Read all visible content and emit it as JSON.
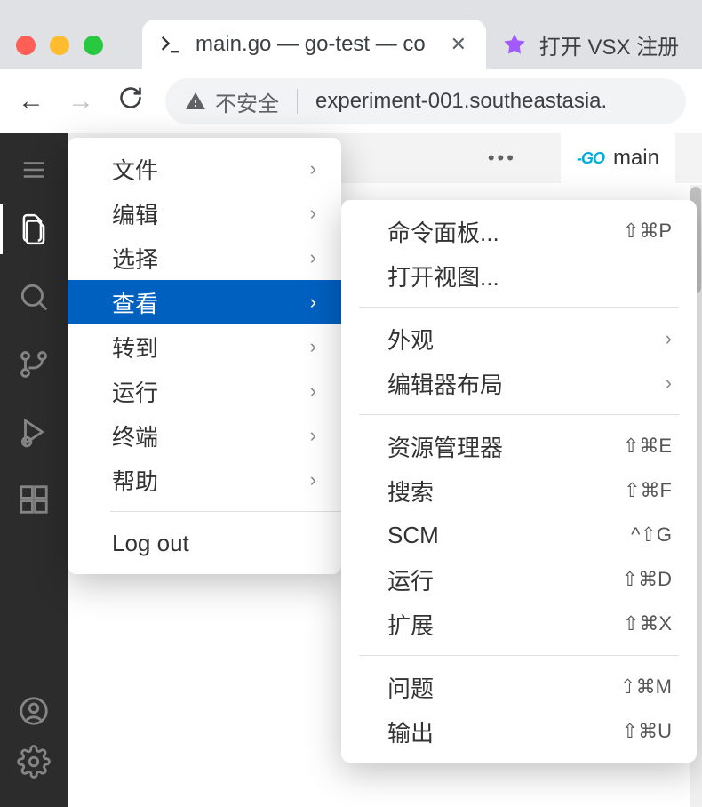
{
  "browser": {
    "tabs": [
      {
        "title": "main.go — go-test — co",
        "active": true
      },
      {
        "title": "打开 VSX 注册",
        "active": false
      }
    ],
    "security_label": "不安全",
    "url": "experiment-001.southeastasia."
  },
  "editor": {
    "tab_title": "main"
  },
  "main_menu": {
    "items": [
      {
        "label": "文件",
        "submenu": true
      },
      {
        "label": "编辑",
        "submenu": true
      },
      {
        "label": "选择",
        "submenu": true
      },
      {
        "label": "查看",
        "submenu": true,
        "active": true
      },
      {
        "label": "转到",
        "submenu": true
      },
      {
        "label": "运行",
        "submenu": true
      },
      {
        "label": "终端",
        "submenu": true
      },
      {
        "label": "帮助",
        "submenu": true
      }
    ],
    "logout": "Log out"
  },
  "view_menu": {
    "g1": [
      {
        "label": "命令面板...",
        "shortcut": "⇧⌘P"
      },
      {
        "label": "打开视图..."
      }
    ],
    "g2": [
      {
        "label": "外观",
        "submenu": true
      },
      {
        "label": "编辑器布局",
        "submenu": true
      }
    ],
    "g3": [
      {
        "label": "资源管理器",
        "shortcut": "⇧⌘E"
      },
      {
        "label": "搜索",
        "shortcut": "⇧⌘F"
      },
      {
        "label": "SCM",
        "shortcut": "^⇧G"
      },
      {
        "label": "运行",
        "shortcut": "⇧⌘D"
      },
      {
        "label": "扩展",
        "shortcut": "⇧⌘X"
      }
    ],
    "g4": [
      {
        "label": "问题",
        "shortcut": "⇧⌘M"
      },
      {
        "label": "输出",
        "shortcut": "⇧⌘U"
      }
    ]
  }
}
